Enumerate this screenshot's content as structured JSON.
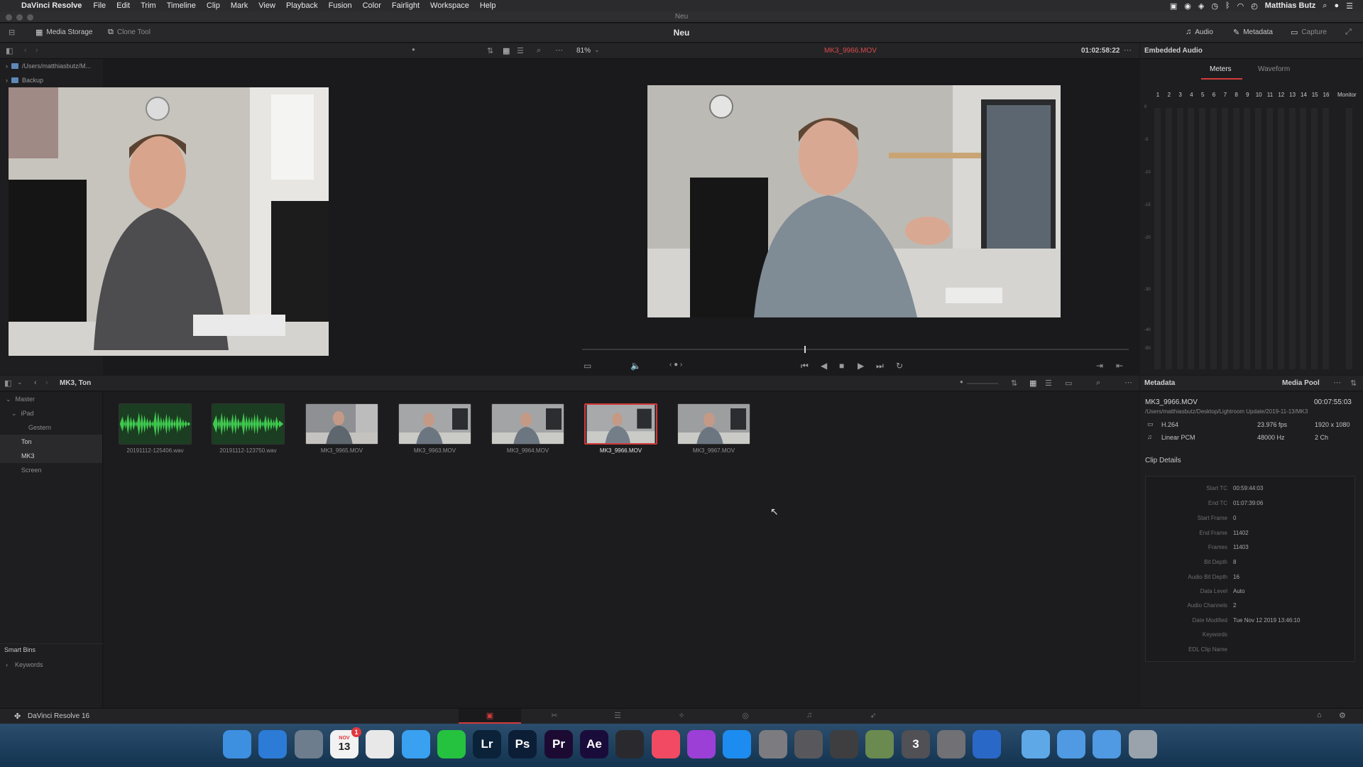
{
  "menubar": {
    "apple_glyph": "",
    "app_name": "DaVinci Resolve",
    "items": [
      "File",
      "Edit",
      "Trim",
      "Timeline",
      "Clip",
      "Mark",
      "View",
      "Playback",
      "Fusion",
      "Color",
      "Fairlight",
      "Workspace",
      "Help"
    ],
    "user": "Matthias Butz"
  },
  "window": {
    "title": "Neu"
  },
  "toolbar": {
    "media_storage": "Media Storage",
    "clone_tool": "Clone Tool",
    "project_title": "Neu",
    "audio": "Audio",
    "metadata": "Metadata",
    "capture": "Capture"
  },
  "storage": {
    "tree": [
      {
        "label": "/Users/matthiasbutz/M..."
      },
      {
        "label": "Backup"
      }
    ]
  },
  "viewer": {
    "zoom": "81%",
    "clip_name": "MK3_9966.MOV",
    "timecode": "01:02:58:22"
  },
  "audio": {
    "title": "Embedded Audio",
    "tabs": [
      "Meters",
      "Waveform"
    ],
    "channels": [
      "1",
      "2",
      "3",
      "4",
      "5",
      "6",
      "7",
      "8",
      "9",
      "10",
      "11",
      "12",
      "13",
      "14",
      "15",
      "16"
    ],
    "monitor": "Monitor",
    "db_marks": [
      "0",
      "-5",
      "-10",
      "-15",
      "-20",
      "-30",
      "-40",
      "-50"
    ]
  },
  "pool": {
    "breadcrumb": "MK3, Ton",
    "bins": [
      {
        "label": "Master",
        "indent": 0
      },
      {
        "label": "iPad",
        "indent": 1
      },
      {
        "label": "Gestern",
        "indent": 2
      },
      {
        "label": "Ton",
        "indent": 1
      },
      {
        "label": "MK3",
        "indent": 1
      },
      {
        "label": "Screen",
        "indent": 1
      }
    ],
    "smart_bins": "Smart Bins",
    "keywords": "Keywords",
    "clips": [
      {
        "name": "20191112-125406.wav",
        "kind": "audio"
      },
      {
        "name": "20191112-123750.wav",
        "kind": "audio"
      },
      {
        "name": "MK3_9965.MOV",
        "kind": "video"
      },
      {
        "name": "MK3_9963.MOV",
        "kind": "video"
      },
      {
        "name": "MK3_9964.MOV",
        "kind": "video"
      },
      {
        "name": "MK3_9966.MOV",
        "kind": "video",
        "selected": true
      },
      {
        "name": "MK3_9967.MOV",
        "kind": "video"
      }
    ]
  },
  "metadata": {
    "title": "Metadata",
    "media_pool": "Media Pool",
    "clip_name": "MK3_9966.MOV",
    "duration": "00:07:55:03",
    "path": "/Users/matthiasbutz/Desktop/Lightroom Update/2019-11-13/MK3",
    "video_codec": "H.264",
    "fps": "23.976 fps",
    "resolution": "1920 x 1080",
    "audio_codec": "Linear PCM",
    "sample_rate": "48000 Hz",
    "audio_ch": "2 Ch",
    "clip_details": "Clip Details",
    "details": [
      {
        "k": "Start TC",
        "v": "00:59:44:03"
      },
      {
        "k": "End TC",
        "v": "01:07:39:06"
      },
      {
        "k": "Start Frame",
        "v": "0"
      },
      {
        "k": "End Frame",
        "v": "11402"
      },
      {
        "k": "Frames",
        "v": "11403"
      },
      {
        "k": "Bit Depth",
        "v": "8"
      },
      {
        "k": "Audio Bit Depth",
        "v": "16"
      },
      {
        "k": "Data Level",
        "v": "Auto"
      },
      {
        "k": "Audio Channels",
        "v": "2"
      },
      {
        "k": "Date Modified",
        "v": "Tue Nov 12 2019 13:46:10"
      },
      {
        "k": "Keywords",
        "v": ""
      },
      {
        "k": "EDL Clip Name",
        "v": ""
      }
    ]
  },
  "footer": {
    "app_label": "DaVinci Resolve 16"
  },
  "dock": {
    "calendar_day": "13",
    "calendar_month": "NOV",
    "badge": "1",
    "icons": [
      {
        "name": "finder",
        "label": "",
        "color": "#3d8fe0"
      },
      {
        "name": "safari",
        "label": "",
        "color": "#2c7bd6"
      },
      {
        "name": "preview",
        "label": "",
        "color": "#6d7d8d"
      },
      {
        "name": "calendar",
        "label": "13",
        "color": "#f2f2f2"
      },
      {
        "name": "photos",
        "label": "",
        "color": "#e8e8e8"
      },
      {
        "name": "messages",
        "label": "",
        "color": "#3aa0f0"
      },
      {
        "name": "whatsapp",
        "label": "",
        "color": "#25c240"
      },
      {
        "name": "lightroom",
        "label": "Lr",
        "color": "#0b2239"
      },
      {
        "name": "photoshop",
        "label": "Ps",
        "color": "#0b1e35"
      },
      {
        "name": "premiere",
        "label": "Pr",
        "color": "#1c0a33"
      },
      {
        "name": "aftereffects",
        "label": "Ae",
        "color": "#1a0c3a"
      },
      {
        "name": "davinci",
        "label": "",
        "color": "#2a2a2e"
      },
      {
        "name": "music",
        "label": "",
        "color": "#f24a63"
      },
      {
        "name": "podcasts",
        "label": "",
        "color": "#9b3fd6"
      },
      {
        "name": "appstore",
        "label": "",
        "color": "#1d8cf0"
      },
      {
        "name": "system-prefs",
        "label": "",
        "color": "#7c7c80"
      },
      {
        "name": "screenshot",
        "label": "",
        "color": "#58585c"
      },
      {
        "name": "capture",
        "label": "",
        "color": "#3e3e40"
      },
      {
        "name": "other-app",
        "label": "",
        "color": "#6a8a50"
      },
      {
        "name": "photo-booth",
        "label": "3",
        "color": "#505055"
      },
      {
        "name": "motion",
        "label": "",
        "color": "#707075"
      },
      {
        "name": "compressor",
        "label": "",
        "color": "#2a68c8"
      },
      {
        "name": "folder-1",
        "label": "",
        "color": "#5fa8e8"
      },
      {
        "name": "folder-2",
        "label": "",
        "color": "#4f9ae2"
      },
      {
        "name": "folder-3",
        "label": "",
        "color": "#4f9ae2"
      },
      {
        "name": "trash",
        "label": "",
        "color": "#9aa3ac"
      }
    ]
  },
  "colors": {
    "accent_red": "#d23a3a",
    "waveform_green": "#3fc84f"
  }
}
